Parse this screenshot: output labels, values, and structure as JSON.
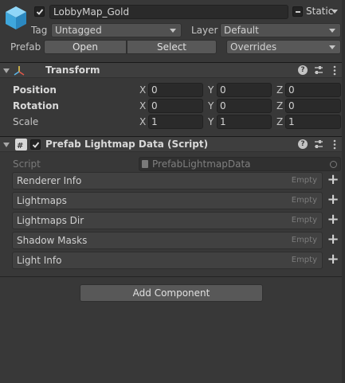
{
  "header": {
    "object_name": "LobbyMap_Gold",
    "static_label": "Static",
    "tag_label": "Tag",
    "tag_value": "Untagged",
    "layer_label": "Layer",
    "layer_value": "Default",
    "prefab_label": "Prefab",
    "open_label": "Open",
    "select_label": "Select",
    "overrides_label": "Overrides"
  },
  "transform": {
    "title": "Transform",
    "rows": [
      {
        "label": "Position",
        "x": "0",
        "y": "0",
        "z": "0"
      },
      {
        "label": "Rotation",
        "x": "0",
        "y": "0",
        "z": "0"
      },
      {
        "label": "Scale",
        "x": "1",
        "y": "1",
        "z": "1"
      }
    ],
    "axis": {
      "x": "X",
      "y": "Y",
      "z": "Z"
    }
  },
  "script_component": {
    "title": "Prefab Lightmap Data (Script)",
    "script_label": "Script",
    "script_value": "PrefabLightmapData",
    "lists": [
      {
        "label": "Renderer Info",
        "state": "Empty"
      },
      {
        "label": "Lightmaps",
        "state": "Empty"
      },
      {
        "label": "Lightmaps Dir",
        "state": "Empty"
      },
      {
        "label": "Shadow Masks",
        "state": "Empty"
      },
      {
        "label": "Light Info",
        "state": "Empty"
      }
    ]
  },
  "add_component_label": "Add Component",
  "colors": {
    "background": "#383838",
    "field": "#2a2a2a",
    "button": "#585858",
    "cube_icon": "#52b5e8"
  },
  "icons": {
    "gameobject": "cube-icon",
    "transform": "transform-axes-icon",
    "script": "csharp-script-icon",
    "help": "help-icon",
    "presets": "presets-icon",
    "menu": "kebab-menu-icon",
    "add": "plus-icon",
    "target": "object-picker-icon"
  }
}
